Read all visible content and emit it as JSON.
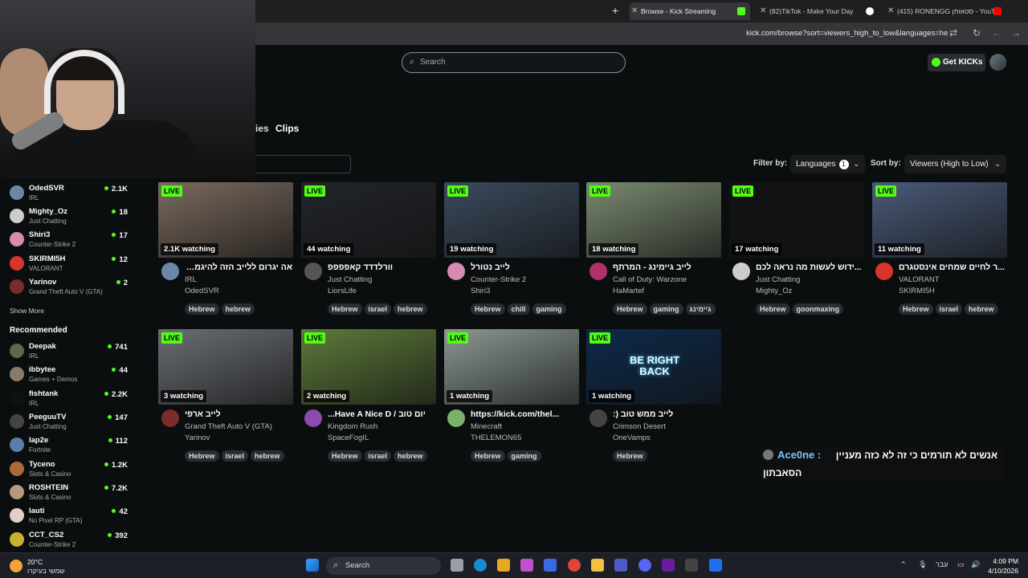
{
  "browser": {
    "tabs": [
      {
        "title": "Browse - Kick Streaming",
        "color": "#53fc18"
      },
      {
        "title": "(82)TikTok - Make Your Day",
        "color": "#ffffff"
      },
      {
        "title": "(415) RONENGG סטאותן - YouT",
        "color": "#ff0000"
      }
    ],
    "url": "kick.com/browse?sort=viewers_high_to_low&languages=he"
  },
  "header": {
    "search_placeholder": "Search",
    "get_kicks": "Get KICKs"
  },
  "page_tabs": {
    "partial": "ies",
    "clips": "Clips"
  },
  "filters": {
    "filter_by": "Filter by:",
    "languages": "Languages",
    "languages_count": "1",
    "sort_by": "Sort by:",
    "sort_value": "Viewers (High to Low)"
  },
  "following": [
    {
      "name": "OdedSVR",
      "category": "IRL",
      "viewers": "2.1K",
      "color": "#6b87a8"
    },
    {
      "name": "Mighty_Oz",
      "category": "Just Chatting",
      "viewers": "18",
      "color": "#cccccc"
    },
    {
      "name": "Shiri3",
      "category": "Counter-Strike 2",
      "viewers": "17",
      "color": "#d98ab0"
    },
    {
      "name": "SKIRMI5H",
      "category": "VALORANT",
      "viewers": "12",
      "color": "#d9342b"
    },
    {
      "name": "Yarinov",
      "category": "Grand Theft Auto V (GTA)",
      "viewers": "2",
      "color": "#7a2d2d"
    }
  ],
  "show_more": "Show More",
  "recommended_title": "Recommended",
  "recommended": [
    {
      "name": "Deepak",
      "category": "IRL",
      "viewers": "741",
      "color": "#5a6b4a"
    },
    {
      "name": "ibbytee",
      "category": "Games + Demos",
      "viewers": "44",
      "color": "#8a7a6a"
    },
    {
      "name": "fishtank",
      "category": "IRL",
      "viewers": "2.2K",
      "color": "#111111"
    },
    {
      "name": "PeeguuTV",
      "category": "Just Chatting",
      "viewers": "147",
      "color": "#444444"
    },
    {
      "name": "lap2e",
      "category": "Fortnite",
      "viewers": "112",
      "color": "#5a7fa8"
    },
    {
      "name": "Tyceno",
      "category": "Slots & Casino",
      "viewers": "1.2K",
      "color": "#a86a3a"
    },
    {
      "name": "ROSHTEIN",
      "category": "Slots & Casino",
      "viewers": "7.2K",
      "color": "#b89a7a"
    },
    {
      "name": "lauti",
      "category": "No Pixel RP (GTA)",
      "viewers": "42",
      "color": "#e0d0c8"
    },
    {
      "name": "CCT_CS2",
      "category": "Counter-Strike 2",
      "viewers": "392",
      "color": "#c8b030"
    }
  ],
  "live_label": "LIVE",
  "streams": [
    {
      "watching": "2.1K watching",
      "title": "אה יגרום ללייב הזה להיגמר...",
      "category": "IRL",
      "user": "OdedSVR",
      "tags": [
        "Hebrew",
        "hebrew"
      ],
      "thumb": "#7a6a5e",
      "avatar": "#6b87a8"
    },
    {
      "watching": "44 watching",
      "title": "וורלדדד קאפפפפ",
      "category": "Just Chatting",
      "user": "LiorsLife",
      "tags": [
        "Hebrew",
        "israel",
        "hebrew"
      ],
      "thumb": "#22252a",
      "avatar": "#555555"
    },
    {
      "watching": "19 watching",
      "title": "לייב נטורל",
      "category": "Counter-Strike 2",
      "user": "Shiri3",
      "tags": [
        "Hebrew",
        "chill",
        "gaming"
      ],
      "thumb": "#3b4a5c",
      "avatar": "#d98ab0"
    },
    {
      "watching": "18 watching",
      "title": "לייב גיימינג - המרתף",
      "category": "Call of Duty: Warzone",
      "user": "HaMartef",
      "tags": [
        "Hebrew",
        "gaming",
        "גיימינג"
      ],
      "thumb": "#7a8a70",
      "avatar": "#b0306a"
    },
    {
      "watching": "17 watching",
      "title": "...ידוש לעשות מה נראה לכם",
      "category": "Just Chatting",
      "user": "Mighty_Oz",
      "tags": [
        "Hebrew",
        "goonmaxing"
      ],
      "thumb": "#121212",
      "avatar": "#cccccc"
    },
    {
      "watching": "11 watching",
      "title": "...ר לחיים שמחים אינסטגרם",
      "category": "VALORANT",
      "user": "SKIRMI5H",
      "tags": [
        "Hebrew",
        "israel",
        "hebrew"
      ],
      "thumb": "#4a5a78",
      "avatar": "#d9342b"
    },
    {
      "watching": "3 watching",
      "title": "לייב ארפי",
      "category": "Grand Theft Auto V (GTA)",
      "user": "Yarinov",
      "tags": [
        "Hebrew",
        "israel",
        "hebrew"
      ],
      "thumb": "#6a6e74",
      "avatar": "#7a2d2d"
    },
    {
      "watching": "2 watching",
      "title": "יום טוב / Have A Nice D...",
      "category": "Kingdom Rush",
      "user": "SpaceFogIL",
      "tags": [
        "Hebrew",
        "israel",
        "hebrew"
      ],
      "thumb": "#5e7a3a",
      "avatar": "#8a4ab0"
    },
    {
      "watching": "1 watching",
      "title": "https://kick.com/thel...",
      "category": "Minecraft",
      "user": "THELEMON65",
      "tags": [
        "Hebrew",
        "gaming"
      ],
      "thumb": "#8a9890",
      "avatar": "#7ab06a"
    },
    {
      "watching": "1 watching",
      "title": "לייב ממש טוב (:",
      "category": "Crimson Desert",
      "user": "OneVamps",
      "tags": [
        "Hebrew"
      ],
      "thumb": "#0e2a4a",
      "avatar": "#444444"
    }
  ],
  "brb_text": "BE RIGHT BACK",
  "chat": {
    "user": "Ace0ne",
    "separator": ":",
    "line1": "אנשים לא תורמים כי זה לא כזה מעניין",
    "line2": "הסאבתון"
  },
  "taskbar": {
    "temp": "20°C",
    "weather": "שמשי בעיקרו",
    "search": "Search",
    "lang": "עבר",
    "time": "4:09 PM",
    "date": "4/10/2026"
  }
}
